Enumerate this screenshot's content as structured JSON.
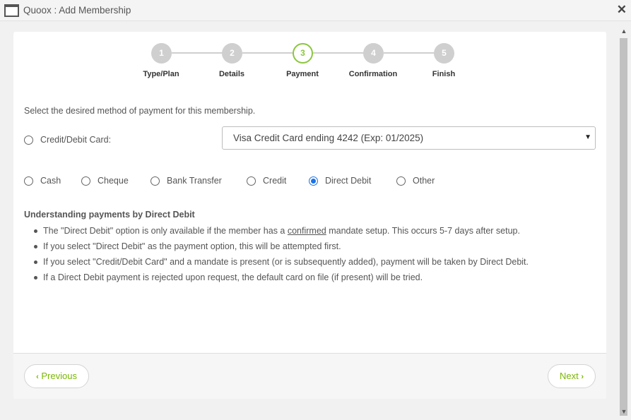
{
  "window": {
    "title": "Quoox : Add Membership",
    "icon": "window-icon",
    "close_icon": "close-icon",
    "close_glyph": "✕"
  },
  "wizard": {
    "steps": [
      {
        "number": "1",
        "label": "Type/Plan",
        "state": "inactive"
      },
      {
        "number": "2",
        "label": "Details",
        "state": "inactive"
      },
      {
        "number": "3",
        "label": "Payment",
        "state": "active"
      },
      {
        "number": "4",
        "label": "Confirmation",
        "state": "inactive"
      },
      {
        "number": "5",
        "label": "Finish",
        "state": "inactive"
      }
    ],
    "active_color": "#8cc63f",
    "inactive_color": "#cfcfcf"
  },
  "payment": {
    "prompt": "Select the desired method of payment for this membership.",
    "card_option": {
      "label": "Credit/Debit Card:",
      "checked": false
    },
    "card_select": {
      "selected": "Visa Credit Card ending 4242 (Exp: 01/2025)"
    },
    "methods": [
      {
        "label": "Cash",
        "checked": false
      },
      {
        "label": "Cheque",
        "checked": false
      },
      {
        "label": "Bank Transfer",
        "checked": false
      },
      {
        "label": "Credit",
        "checked": false
      },
      {
        "label": "Direct Debit",
        "checked": true
      },
      {
        "label": "Other",
        "checked": false
      }
    ]
  },
  "info": {
    "title": "Understanding payments by Direct Debit",
    "bullet1_pre": "The \"Direct Debit\" option is only available if the member has a ",
    "bullet1_link": "confirmed",
    "bullet1_post": " mandate setup. This occurs 5-7 days after setup.",
    "bullet2": "If you select \"Direct Debit\" as the payment option, this will be attempted first.",
    "bullet3": "If you select \"Credit/Debit Card\" and a mandate is present (or is subsequently added), payment will be taken by Direct Debit.",
    "bullet4": "If a Direct Debit payment is rejected upon request, the default card on file (if present) will be tried."
  },
  "footer": {
    "previous_label": "Previous",
    "previous_glyph": "‹",
    "next_label": "Next",
    "next_glyph": "›",
    "accent_color": "#7ab800"
  }
}
